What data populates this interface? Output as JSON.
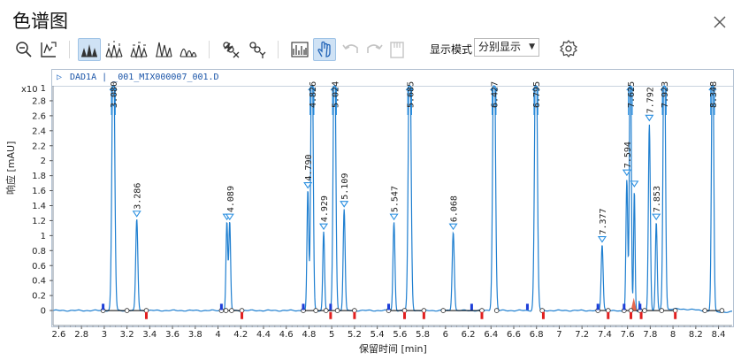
{
  "window": {
    "title": "色谱图"
  },
  "display_mode": {
    "label": "显示模式",
    "value": "分别显示"
  },
  "signal_header": {
    "detector": "DAD1A",
    "file": "_001_MIX000007_001.D"
  },
  "colors": {
    "trace": "#1f7fd0",
    "baseline": "#000000",
    "mark_start": "#1d3ed8",
    "mark_end": "#e02020",
    "peak_marker": "#2a8fe0",
    "overlap_fill": "#e04020"
  },
  "toolbar": {
    "icons": [
      "zoom-out-icon",
      "autoscale-icon",
      "peak-view-1-icon",
      "peak-view-2-icon",
      "peak-view-3-icon",
      "peak-view-4-icon",
      "peak-view-5-icon",
      "link-x-icon",
      "link-y-icon",
      "histogram-icon",
      "hand-pan-icon",
      "undo-icon",
      "redo-icon",
      "export-icon",
      "settings-icon"
    ]
  },
  "chart_data": {
    "type": "line",
    "xlabel": "保留时间 [min]",
    "ylabel": "响应 [mAU]",
    "y_exponent": "x10",
    "xlim": [
      2.55,
      8.52
    ],
    "ylim": [
      -0.2,
      3.0
    ],
    "x_ticks": [
      2.6,
      2.8,
      3.0,
      3.2,
      3.4,
      3.6,
      3.8,
      4.0,
      4.2,
      4.4,
      4.6,
      4.8,
      5.0,
      5.2,
      5.4,
      5.6,
      5.8,
      6.0,
      6.2,
      6.4,
      6.6,
      6.8,
      7.0,
      7.2,
      7.4,
      7.6,
      7.8,
      8.0,
      8.2,
      8.4
    ],
    "x_tick_labels": [
      "2.6",
      "2.8",
      "3",
      "3.2",
      "3.4",
      "3.6",
      "3.8",
      "4",
      "4.2",
      "4.4",
      "4.6",
      "4.8",
      "5",
      "5.2",
      "5.4",
      "5.6",
      "5.8",
      "6",
      "6.2",
      "6.4",
      "6.6",
      "6.8",
      "7",
      "7.2",
      "7.4",
      "7.6",
      "7.8",
      "8",
      "8.2",
      "8.4"
    ],
    "y_ticks": [
      0,
      0.2,
      0.4,
      0.6,
      0.8,
      1.0,
      1.2,
      1.4,
      1.6,
      1.8,
      2.0,
      2.2,
      2.4,
      2.6,
      2.8
    ],
    "y_tick_labels": [
      "0",
      "0.2",
      "0.4",
      "0.6",
      "0.8",
      "1",
      "1.2",
      "1.4",
      "1.6",
      "1.8",
      "2",
      "2.2",
      "2.4",
      "2.6",
      "2.8"
    ],
    "peaks": [
      {
        "rt": 3.08,
        "label": "3.080",
        "height": 4.0,
        "width": 0.016,
        "clipped": true
      },
      {
        "rt": 3.286,
        "label": "3.286",
        "height": 1.22,
        "width": 0.013
      },
      {
        "rt": 4.078,
        "label": "",
        "height": 1.18,
        "width": 0.011
      },
      {
        "rt": 4.103,
        "label": "4.089",
        "height": 1.18,
        "width": 0.011
      },
      {
        "rt": 4.79,
        "label": "4.790",
        "height": 1.6,
        "width": 0.011
      },
      {
        "rt": 4.826,
        "label": "4.826",
        "height": 4.0,
        "width": 0.014,
        "clipped": true
      },
      {
        "rt": 4.929,
        "label": "4.929",
        "height": 1.05,
        "width": 0.011
      },
      {
        "rt": 5.024,
        "label": "5.024",
        "height": 4.0,
        "width": 0.015,
        "clipped": true
      },
      {
        "rt": 5.109,
        "label": "5.109",
        "height": 1.35,
        "width": 0.012
      },
      {
        "rt": 5.547,
        "label": "5.547",
        "height": 1.18,
        "width": 0.012
      },
      {
        "rt": 5.685,
        "label": "5.685",
        "height": 4.0,
        "width": 0.016,
        "clipped": true
      },
      {
        "rt": 6.068,
        "label": "6.068",
        "height": 1.05,
        "width": 0.013
      },
      {
        "rt": 6.427,
        "label": "6.427",
        "height": 4.0,
        "width": 0.016,
        "clipped": true
      },
      {
        "rt": 6.795,
        "label": "6.795",
        "height": 4.0,
        "width": 0.016,
        "clipped": true
      },
      {
        "rt": 7.377,
        "label": "7.377",
        "height": 0.88,
        "width": 0.012
      },
      {
        "rt": 7.594,
        "label": "7.594",
        "height": 1.77,
        "width": 0.011
      },
      {
        "rt": 7.625,
        "label": "7.625",
        "height": 4.0,
        "width": 0.011,
        "clipped": true
      },
      {
        "rt": 7.66,
        "label": "",
        "height": 1.62,
        "width": 0.009
      },
      {
        "rt": 7.792,
        "label": "7.792",
        "height": 2.5,
        "width": 0.012
      },
      {
        "rt": 7.853,
        "label": "7.853",
        "height": 1.18,
        "width": 0.011
      },
      {
        "rt": 7.923,
        "label": "7.923",
        "height": 4.0,
        "width": 0.014,
        "clipped": true
      },
      {
        "rt": 8.348,
        "label": "8.348",
        "height": 4.0,
        "width": 0.013,
        "clipped": true
      }
    ],
    "start_marks": [
      2.99,
      4.03,
      4.75,
      4.99,
      5.5,
      6.23,
      6.72,
      7.34,
      7.57,
      7.71
    ],
    "end_marks": [
      3.37,
      4.21,
      4.99,
      5.2,
      5.64,
      5.81,
      6.32,
      6.86,
      7.43,
      7.63,
      7.72,
      8.02
    ],
    "baseline_segments": [
      [
        2.99,
        3.37
      ],
      [
        4.03,
        4.21
      ],
      [
        4.75,
        5.2
      ],
      [
        5.5,
        5.81
      ],
      [
        5.98,
        6.32
      ],
      [
        7.34,
        7.43
      ],
      [
        7.57,
        8.02
      ],
      [
        8.28,
        8.43
      ]
    ],
    "baseline_points": [
      2.99,
      3.2,
      3.37,
      4.03,
      4.07,
      4.12,
      4.21,
      4.75,
      4.86,
      4.95,
      5.05,
      5.2,
      5.5,
      5.64,
      5.81,
      5.98,
      6.32,
      6.45,
      6.85,
      7.34,
      7.43,
      7.57,
      7.63,
      7.71,
      7.75,
      7.9,
      8.02,
      8.28,
      8.43
    ]
  }
}
